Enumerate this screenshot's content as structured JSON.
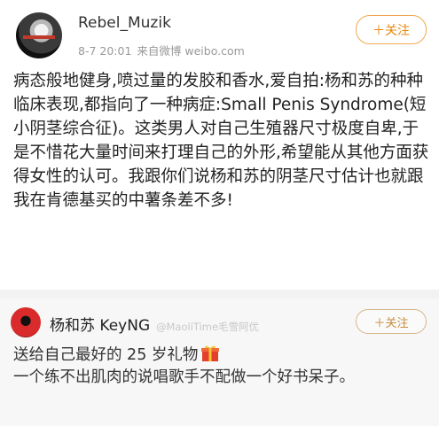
{
  "post": {
    "author": "Rebel_Muzik",
    "date": "8-7 20:01",
    "source": "来自微博 weibo.com",
    "follow_label": "＋关注",
    "text": "病态般地健身,喷过量的发胶和香水,爱自拍:杨和苏的种种临床表现,都指向了一种病症:Small Penis Syndrome(短小阴茎综合征)。这类男人对自己生殖器尺寸极度自卑,于是不惜花大量时间来打理自己的外形,希望能从其他方面获得女性的认可。我跟你们说杨和苏的阴茎尺寸估计也就跟我在肯德基买的中薯条差不多!"
  },
  "repost": {
    "author": "杨和苏 KeyNG",
    "watermark": "@MaoliTime毛雪阿优",
    "follow_label": "＋关注",
    "line1": "送给自己最好的 25 岁礼物",
    "line2": "一个练不出肌肉的说唱歌手不配做一个好书呆子。"
  },
  "colors": {
    "accent": "#e8870d",
    "separator": "#f2f2f2",
    "repost_bg": "#f7f7f7"
  },
  "icons": {
    "gift": "gift-icon"
  }
}
